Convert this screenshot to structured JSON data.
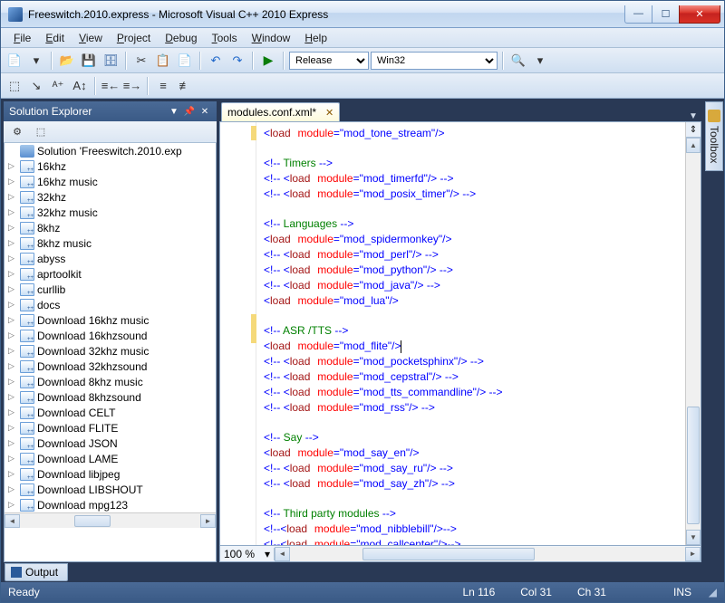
{
  "window": {
    "title": "Freeswitch.2010.express - Microsoft Visual C++ 2010 Express"
  },
  "menu": [
    "File",
    "Edit",
    "View",
    "Project",
    "Debug",
    "Tools",
    "Window",
    "Help"
  ],
  "toolbar": {
    "config": "Release",
    "platform": "Win32"
  },
  "solution_panel": {
    "title": "Solution Explorer"
  },
  "tree": {
    "root": "Solution 'Freeswitch.2010.exp",
    "items": [
      "16khz",
      "16khz music",
      "32khz",
      "32khz music",
      "8khz",
      "8khz music",
      "abyss",
      "aprtoolkit",
      "curllib",
      "docs",
      "Download 16khz music",
      "Download 16khzsound",
      "Download 32khz music",
      "Download 32khzsound",
      "Download 8khz music",
      "Download 8khzsound",
      "Download CELT",
      "Download FLITE",
      "Download JSON",
      "Download LAME",
      "Download libjpeg",
      "Download LIBSHOUT",
      "Download mpg123"
    ]
  },
  "tab": {
    "label": "modules.conf.xml*"
  },
  "right_rail": {
    "toolbox": "Toolbox"
  },
  "bottom_tabs": {
    "output": "Output"
  },
  "editor": {
    "zoom": "100 %"
  },
  "code_lines": [
    {
      "t": "load",
      "mod": "mod_tone_stream"
    },
    {
      "t": "blank"
    },
    {
      "t": "comment",
      "text": " Timers "
    },
    {
      "t": "cload",
      "mod": "mod_timerfd"
    },
    {
      "t": "cload",
      "mod": "mod_posix_timer"
    },
    {
      "t": "blank"
    },
    {
      "t": "comment",
      "text": " Languages "
    },
    {
      "t": "load",
      "mod": "mod_spidermonkey"
    },
    {
      "t": "cload",
      "mod": "mod_perl"
    },
    {
      "t": "cload",
      "mod": "mod_python"
    },
    {
      "t": "cload",
      "mod": "mod_java"
    },
    {
      "t": "load",
      "mod": "mod_lua"
    },
    {
      "t": "blank"
    },
    {
      "t": "comment",
      "text": " ASR /TTS "
    },
    {
      "t": "load",
      "mod": "mod_flite",
      "cursor": true
    },
    {
      "t": "cload",
      "mod": "mod_pocketsphinx"
    },
    {
      "t": "cload",
      "mod": "mod_cepstral"
    },
    {
      "t": "cload",
      "mod": "mod_tts_commandline"
    },
    {
      "t": "cload",
      "mod": "mod_rss"
    },
    {
      "t": "blank"
    },
    {
      "t": "comment",
      "text": " Say "
    },
    {
      "t": "load",
      "mod": "mod_say_en"
    },
    {
      "t": "cload",
      "mod": "mod_say_ru"
    },
    {
      "t": "cload",
      "mod": "mod_say_zh"
    },
    {
      "t": "blank"
    },
    {
      "t": "comment",
      "text": " Third party modules "
    },
    {
      "t": "cload2",
      "mod": "mod_nibblebill"
    },
    {
      "t": "cload2",
      "mod": "mod_callcenter"
    }
  ],
  "status": {
    "ready": "Ready",
    "ln": "Ln 116",
    "col": "Col 31",
    "ch": "Ch 31",
    "ins": "INS"
  }
}
